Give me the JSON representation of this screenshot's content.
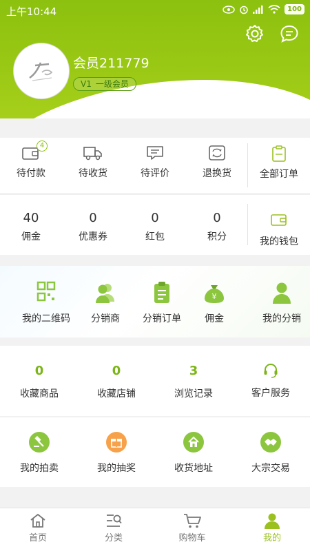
{
  "status_bar": {
    "time": "上午10:44",
    "battery": "100"
  },
  "profile": {
    "username": "会员211779",
    "level_code": "V1",
    "level_name": "一级会员"
  },
  "orders": {
    "items": [
      {
        "label": "待付款",
        "badge": "4"
      },
      {
        "label": "待收货"
      },
      {
        "label": "待评价"
      },
      {
        "label": "退换货"
      }
    ],
    "all_label": "全部订单"
  },
  "wallet": {
    "items": [
      {
        "value": "40",
        "label": "佣金"
      },
      {
        "value": "0",
        "label": "优惠券"
      },
      {
        "value": "0",
        "label": "红包"
      },
      {
        "value": "0",
        "label": "积分"
      }
    ],
    "wallet_label": "我的钱包"
  },
  "distribution": {
    "items": [
      {
        "label": "我的二维码",
        "icon": "qrcode-icon"
      },
      {
        "label": "分销商",
        "icon": "users-icon"
      },
      {
        "label": "分销订单",
        "icon": "clipboard-icon"
      },
      {
        "label": "佣金",
        "icon": "moneybag-icon"
      },
      {
        "label": "我的分销",
        "icon": "person-icon"
      }
    ]
  },
  "stats": {
    "items": [
      {
        "value": "0",
        "label": "收藏商品"
      },
      {
        "value": "0",
        "label": "收藏店铺"
      },
      {
        "value": "3",
        "label": "浏览记录"
      }
    ],
    "service_label": "客户服务"
  },
  "services": {
    "items": [
      {
        "label": "我的拍卖",
        "icon": "gavel-icon",
        "color": "#8cc63f"
      },
      {
        "label": "我的抽奖",
        "icon": "gift-icon",
        "color": "#f7a24a"
      },
      {
        "label": "收货地址",
        "icon": "home-icon",
        "color": "#8cc63f"
      },
      {
        "label": "大宗交易",
        "icon": "handshake-icon",
        "color": "#8cc63f"
      }
    ]
  },
  "tabbar": {
    "items": [
      {
        "label": "首页",
        "icon": "home-tab-icon"
      },
      {
        "label": "分类",
        "icon": "category-icon"
      },
      {
        "label": "购物车",
        "icon": "cart-icon"
      },
      {
        "label": "我的",
        "icon": "profile-icon",
        "active": true
      }
    ]
  },
  "colors": {
    "brand_green": "#8cc10f",
    "accent_green": "#7cb518",
    "orange": "#f7a24a"
  }
}
